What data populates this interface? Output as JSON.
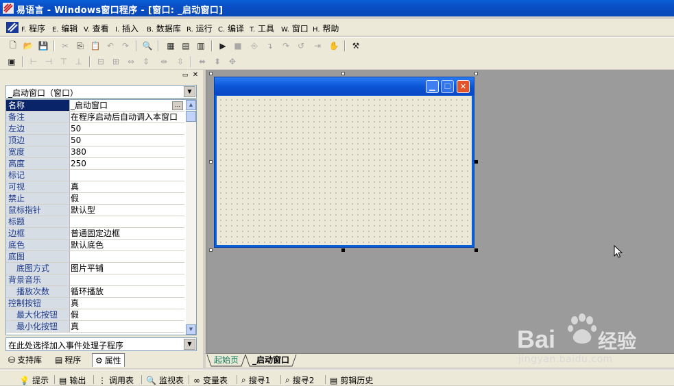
{
  "app": {
    "title": "易语言 - Windows窗口程序 - [窗口: _启动窗口]"
  },
  "menu": [
    {
      "key": "F.",
      "label": "程序"
    },
    {
      "key": "E.",
      "label": "编辑"
    },
    {
      "key": "V.",
      "label": "查看"
    },
    {
      "key": "I.",
      "label": "插入"
    },
    {
      "key": "B.",
      "label": "数据库"
    },
    {
      "key": "R.",
      "label": "运行"
    },
    {
      "key": "C.",
      "label": "编译"
    },
    {
      "key": "T.",
      "label": "工具"
    },
    {
      "key": "W.",
      "label": "窗口"
    },
    {
      "key": "H.",
      "label": "帮助"
    }
  ],
  "object_selector": {
    "value": "_启动窗口（窗口）"
  },
  "properties": [
    {
      "name": "名称",
      "value": "_启动窗口"
    },
    {
      "name": "备注",
      "value": "在程序启动后自动调入本窗口"
    },
    {
      "name": "左边",
      "value": "50"
    },
    {
      "name": "顶边",
      "value": "50"
    },
    {
      "name": "宽度",
      "value": "380"
    },
    {
      "name": "高度",
      "value": "250"
    },
    {
      "name": "标记",
      "value": ""
    },
    {
      "name": "可视",
      "value": "真"
    },
    {
      "name": "禁止",
      "value": "假"
    },
    {
      "name": "鼠标指针",
      "value": "默认型"
    },
    {
      "name": "标题",
      "value": ""
    },
    {
      "name": "边框",
      "value": "普通固定边框"
    },
    {
      "name": "底色",
      "value": "默认底色"
    },
    {
      "name": "底图",
      "value": ""
    },
    {
      "name": "底图方式",
      "value": "图片平铺"
    },
    {
      "name": "背景音乐",
      "value": ""
    },
    {
      "name": "播放次数",
      "value": "循环播放"
    },
    {
      "name": "控制按钮",
      "value": "真"
    },
    {
      "name": "最大化按钮",
      "value": "假"
    },
    {
      "name": "最小化按钮",
      "value": "真"
    }
  ],
  "event_selector": {
    "value": "在此处选择加入事件处理子程序"
  },
  "left_tabs": [
    {
      "label": "支持库"
    },
    {
      "label": "程序"
    },
    {
      "label": "属性"
    }
  ],
  "design_tabs": [
    {
      "label": "起始页"
    },
    {
      "label": "_启动窗口"
    }
  ],
  "bottom_tabs": [
    {
      "label": "提示"
    },
    {
      "label": "输出"
    },
    {
      "label": "调用表"
    },
    {
      "label": "监视表"
    },
    {
      "label": "变量表"
    },
    {
      "label": "搜寻1"
    },
    {
      "label": "搜寻2"
    },
    {
      "label": "剪辑历史"
    }
  ],
  "watermark": {
    "logo_text": "Bai",
    "logo_text2": "经验",
    "url": "jingyan.baidu.com"
  },
  "colors": {
    "titlebar": "#0a4ec4",
    "selected_row": "#0a246a",
    "design_bg": "#9b9b9b"
  }
}
